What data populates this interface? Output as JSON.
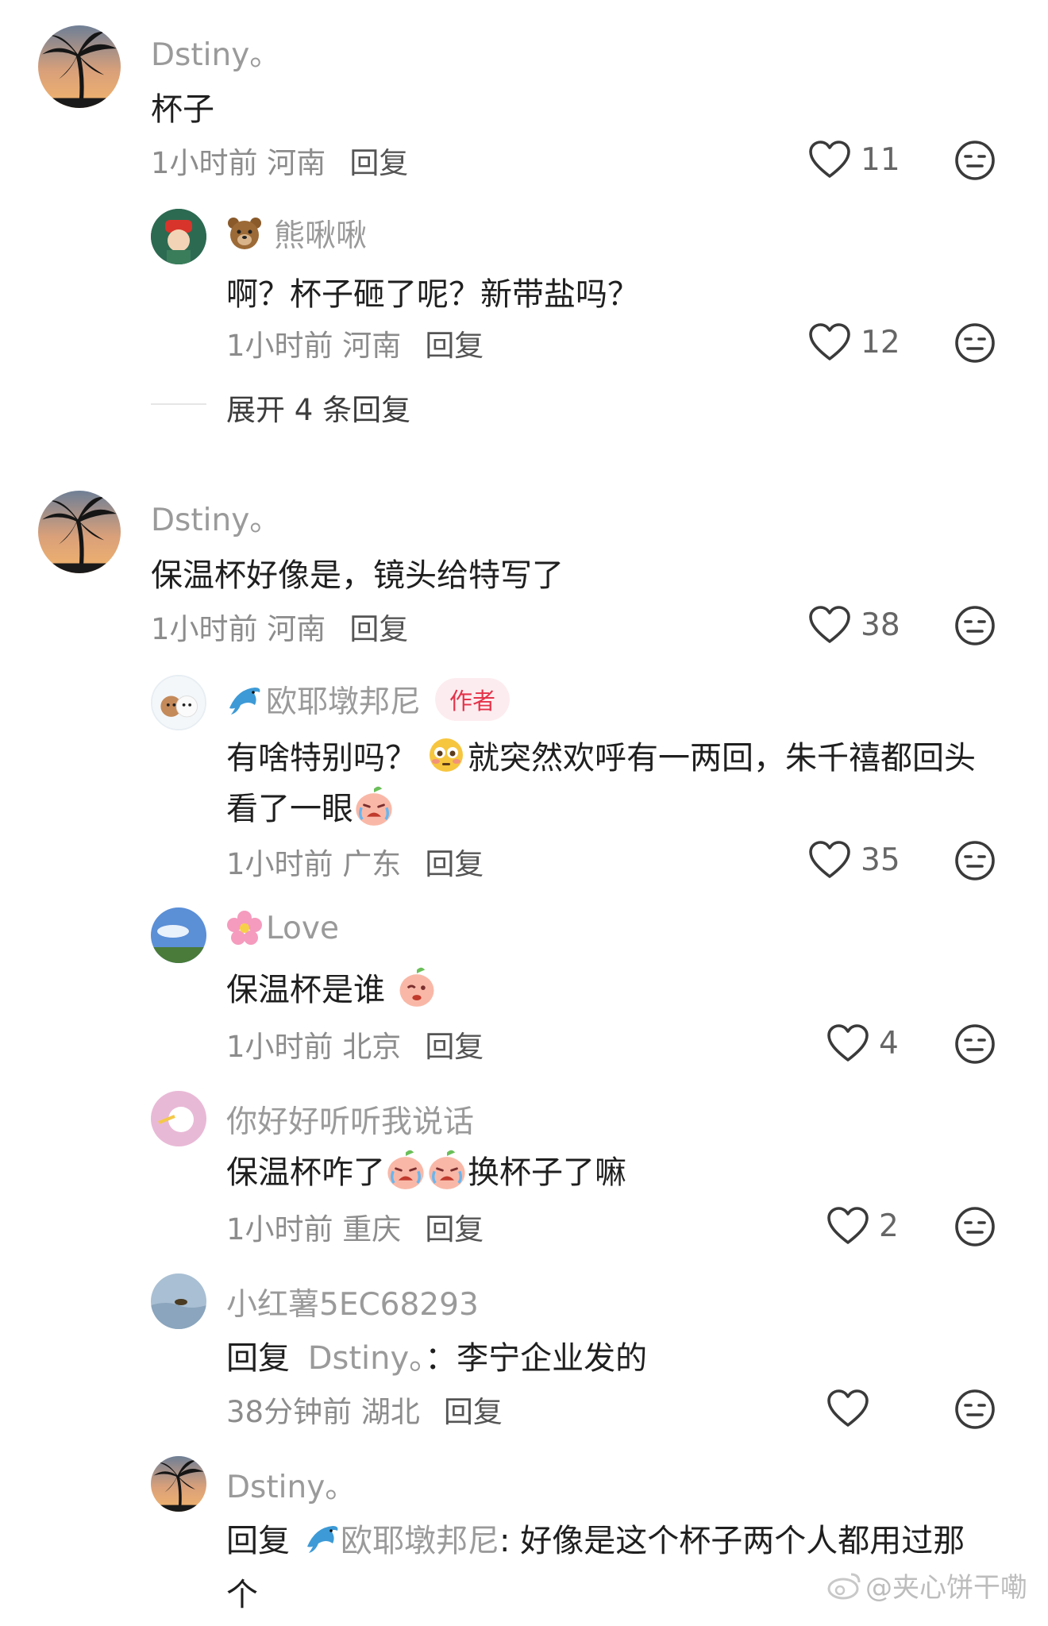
{
  "comments": [
    {
      "user": "Dstiny。",
      "text": "杯子",
      "time_location": "1小时前 河南",
      "reply_label": "回复",
      "likes": "11",
      "replies": [
        {
          "user_emoji": "bear-emoji",
          "user": "熊啾啾",
          "text": "啊？杯子砸了呢？新带盐吗？",
          "time_location": "1小时前 河南",
          "reply_label": "回复",
          "likes": "12"
        }
      ],
      "expand_label": "展开 4 条回复"
    },
    {
      "user": "Dstiny。",
      "text": "保温杯好像是，镜头给特写了",
      "time_location": "1小时前 河南",
      "reply_label": "回复",
      "likes": "38",
      "replies": [
        {
          "user_emoji": "dolphin-emoji",
          "user": "欧耶墩邦尼",
          "badge": "作者",
          "text_part1": "有啥特别吗？",
          "text_part2": "就突然欢呼有一两回，朱千禧都回头",
          "text_line2": "看了一眼",
          "time_location": "1小时前 广东",
          "reply_label": "回复",
          "likes": "35"
        },
        {
          "user_emoji": "cherry-blossom-emoji",
          "user": "Love",
          "text": "保温杯是谁",
          "time_location": "1小时前 北京",
          "reply_label": "回复",
          "likes": "4"
        },
        {
          "user": "你好好听听我说话",
          "text_part1": "保温杯咋了",
          "text_part2": "换杯子了嘛",
          "time_location": "1小时前 重庆",
          "reply_label": "回复",
          "likes": "2"
        },
        {
          "user": "小红薯5EC68293",
          "reply_prefix": "回复",
          "reply_target": "Dstiny。",
          "text": "：李宁企业发的",
          "time_location": "38分钟前 湖北",
          "reply_label": "回复",
          "likes": ""
        },
        {
          "user": "Dstiny。",
          "reply_prefix": "回复",
          "reply_target": "欧耶墩邦尼",
          "text": ": 好像是这个杯子两个人都用过那",
          "text_line2": "个"
        }
      ]
    }
  ],
  "watermark": "@夹心饼干嘞",
  "colors": {
    "author_badge": "#e4334a",
    "username": "#9a9a9a",
    "meta": "#8c8c8c"
  }
}
